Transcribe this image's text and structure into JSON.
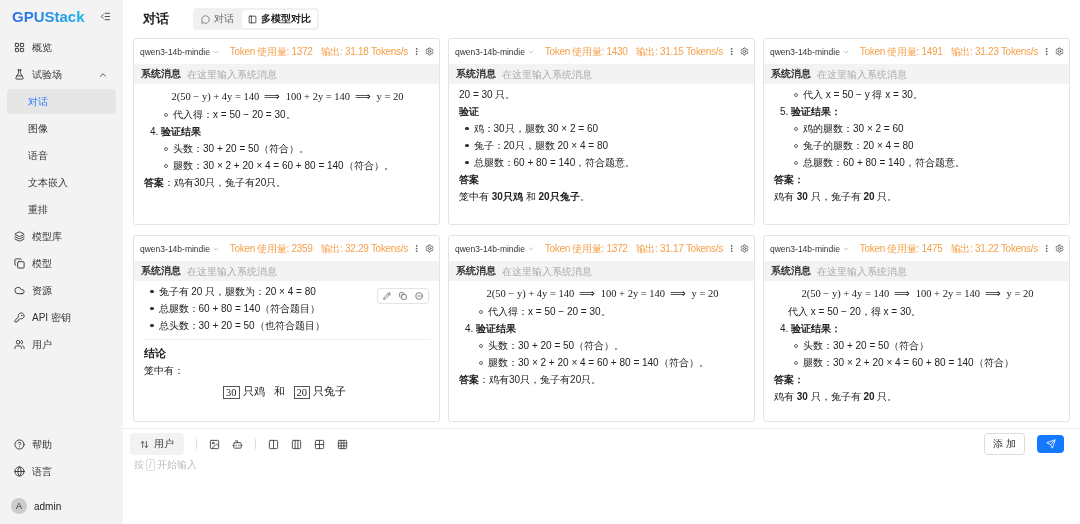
{
  "sidebar": {
    "logo": "GPUStack",
    "items": [
      {
        "label": "概览",
        "selected": false
      },
      {
        "label": "试验场",
        "selected": false,
        "expanded": true,
        "children": [
          {
            "label": "对话",
            "selected": true
          },
          {
            "label": "图像",
            "selected": false
          },
          {
            "label": "语音",
            "selected": false
          },
          {
            "label": "文本嵌入",
            "selected": false
          },
          {
            "label": "重排",
            "selected": false
          }
        ]
      },
      {
        "label": "模型库",
        "selected": false
      },
      {
        "label": "模型",
        "selected": false
      },
      {
        "label": "资源",
        "selected": false
      },
      {
        "label": "API 密钥",
        "selected": false
      },
      {
        "label": "用户",
        "selected": false
      }
    ],
    "bottom_items": [
      {
        "label": "帮助"
      },
      {
        "label": "语言"
      }
    ],
    "user": {
      "initial": "A",
      "name": "admin"
    }
  },
  "header": {
    "title": "对话",
    "tabs": [
      {
        "label": "对话",
        "selected": false
      },
      {
        "label": "多模型对比",
        "selected": true
      }
    ]
  },
  "panels": [
    {
      "model": "qwen3-14b-mindie",
      "tokens": "Token 使用量: 1372",
      "speed": "输出: 31.18 Tokens/s",
      "system_label": "系统消息",
      "system_placeholder": "在这里输入系统消息",
      "content": [
        {
          "kind": "eq",
          "text": "2(50 − y) + 4y = 140  ⟹  100 + 2y = 140  ⟹  y = 20"
        },
        {
          "kind": "sub",
          "text": "代入得：x = 50 − 20 = 30。"
        },
        {
          "kind": "num",
          "text": "4. **验证结果**"
        },
        {
          "kind": "sub",
          "text": "头数：30 + 20 = 50（符合）。"
        },
        {
          "kind": "sub",
          "text": "腿数：30 × 2 + 20 × 4 = 60 + 80 = 140（符合）。"
        },
        {
          "kind": "text",
          "text": "**答案**：鸡有30只，兔子有20只。"
        }
      ]
    },
    {
      "model": "qwen3-14b-mindie",
      "tokens": "Token 使用量: 1430",
      "speed": "输出: 31.15 Tokens/s",
      "system_label": "系统消息",
      "system_placeholder": "在这里输入系统消息",
      "content": [
        {
          "kind": "text",
          "text": "20 = 30 只。"
        },
        {
          "kind": "heading",
          "text": "验证"
        },
        {
          "kind": "bullet",
          "text": "鸡：30只，腿数 30 × 2 = 60"
        },
        {
          "kind": "bullet",
          "text": "兔子：20只，腿数 20 × 4 = 80"
        },
        {
          "kind": "bullet",
          "text": "总腿数：60 + 80 = 140，符合题意。"
        },
        {
          "kind": "heading",
          "text": "答案"
        },
        {
          "kind": "text",
          "text": "笼中有 **30只鸡** 和 **20只兔子**。"
        }
      ]
    },
    {
      "model": "qwen3-14b-mindie",
      "tokens": "Token 使用量: 1491",
      "speed": "输出: 31.23 Tokens/s",
      "system_label": "系统消息",
      "system_placeholder": "在这里输入系统消息",
      "content": [
        {
          "kind": "sub",
          "text": "代入 x = 50 − y 得 x = 30。"
        },
        {
          "kind": "num",
          "text": "5. **验证结果：**"
        },
        {
          "kind": "sub",
          "text": "鸡的腿数：30 × 2 = 60"
        },
        {
          "kind": "sub",
          "text": "兔子的腿数：20 × 4 = 80"
        },
        {
          "kind": "sub",
          "text": "总腿数：60 + 80 = 140，符合题意。"
        },
        {
          "kind": "heading",
          "text": "答案："
        },
        {
          "kind": "text",
          "text": "鸡有 **30** 只，兔子有 **20** 只。"
        }
      ]
    },
    {
      "model": "qwen3-14b-mindie",
      "tokens": "Token 使用量: 2359",
      "speed": "输出: 32.29 Tokens/s",
      "system_label": "系统消息",
      "system_placeholder": "在这里输入系统消息",
      "hover_actions": true,
      "content": [
        {
          "kind": "bullet",
          "text": "兔子有 20 只，腿数为：20 × 4 = 80"
        },
        {
          "kind": "bullet",
          "text": "总腿数：60 + 80 = 140（符合题目）"
        },
        {
          "kind": "bullet",
          "text": "总头数：30 + 20 = 50（也符合题目）"
        },
        {
          "kind": "divider"
        },
        {
          "kind": "title",
          "text": "结论"
        },
        {
          "kind": "text",
          "text": "笼中有："
        },
        {
          "kind": "boxed",
          "segments": [
            {
              "text": "30",
              "boxed": true
            },
            {
              "text": "只鸡",
              "boxed": false
            },
            {
              "text": "和",
              "boxed": false
            },
            {
              "text": "20",
              "boxed": true
            },
            {
              "text": "只兔子",
              "boxed": false
            }
          ]
        }
      ]
    },
    {
      "model": "qwen3-14b-mindie",
      "tokens": "Token 使用量: 1372",
      "speed": "输出: 31.17 Tokens/s",
      "system_label": "系统消息",
      "system_placeholder": "在这里输入系统消息",
      "content": [
        {
          "kind": "eq",
          "text": "2(50 − y) + 4y = 140  ⟹  100 + 2y = 140  ⟹  y = 20"
        },
        {
          "kind": "sub",
          "text": "代入得：x = 50 − 20 = 30。"
        },
        {
          "kind": "num",
          "text": "4. **验证结果**"
        },
        {
          "kind": "sub",
          "text": "头数：30 + 20 = 50（符合）。"
        },
        {
          "kind": "sub",
          "text": "腿数：30 × 2 + 20 × 4 = 60 + 80 = 140（符合）。"
        },
        {
          "kind": "text",
          "text": "**答案**：鸡有30只，兔子有20只。"
        }
      ]
    },
    {
      "model": "qwen3-14b-mindie",
      "tokens": "Token 使用量: 1475",
      "speed": "输出: 31.22 Tokens/s",
      "system_label": "系统消息",
      "system_placeholder": "在这里输入系统消息",
      "content": [
        {
          "kind": "eq",
          "text": "2(50 − y) + 4y = 140  ⟹  100 + 2y = 140  ⟹  y = 20"
        },
        {
          "kind": "indent",
          "text": "代入 x = 50 − 20，得 x = 30。"
        },
        {
          "kind": "num",
          "text": "4. **验证结果：**"
        },
        {
          "kind": "sub",
          "text": "头数：30 + 20 = 50（符合）"
        },
        {
          "kind": "sub",
          "text": "腿数：30 × 2 + 20 × 4 = 60 + 80 = 140（符合）"
        },
        {
          "kind": "heading",
          "text": "答案："
        },
        {
          "kind": "text",
          "text": "鸡有 **30** 只，兔子有 **20** 只。"
        }
      ]
    }
  ],
  "composer": {
    "role_button": "用户",
    "hint_prefix": "按",
    "hint_key": "/",
    "hint_suffix": "开始输入",
    "add_button": "添 加"
  }
}
